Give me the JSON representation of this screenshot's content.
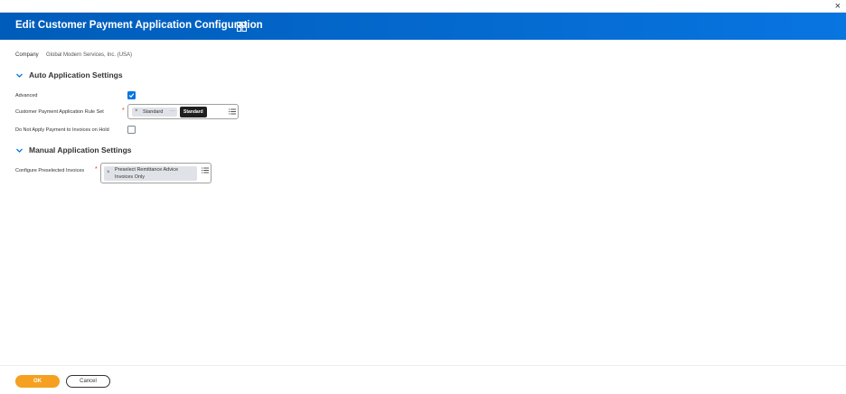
{
  "window": {
    "close_glyph": "×"
  },
  "header": {
    "title": "Edit Customer Payment Application Configuration",
    "icon": "excel-export-icon",
    "bg_color": "#0875e1"
  },
  "company": {
    "label": "Company",
    "value": "Global Modern Services, Inc. (USA)"
  },
  "auto_section": {
    "title": "Auto Application Settings",
    "advanced": {
      "label": "Advanced",
      "checked": true
    },
    "rule_set": {
      "label": "Customer Payment Application Rule Set",
      "required_mark": "*",
      "selected": "Standard",
      "tooltip": "Standard"
    },
    "do_not_apply": {
      "label": "Do Not Apply Payment to Invoices on Hold",
      "checked": false
    }
  },
  "manual_section": {
    "title": "Manual Application Settings",
    "preselected": {
      "label": "Configure Preselected Invoices",
      "required_mark": "*",
      "selected_line1": "Preselect Remittance Advice",
      "selected_line2": "Invoices Only"
    }
  },
  "footer": {
    "ok_label": "OK",
    "cancel_label": "Cancel",
    "ok_color": "#f5a020"
  }
}
